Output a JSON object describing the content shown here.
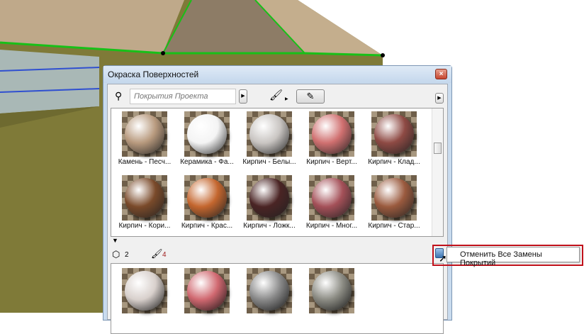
{
  "dialog": {
    "title": "Окраска Поверхностей",
    "close_icon": "×"
  },
  "toolbar": {
    "search_placeholder": "Покрытия Проекта",
    "arrow": "▶",
    "brush_icon": "🖌",
    "eyedropper_icon": "✎"
  },
  "materials": [
    {
      "label": "Камень - Песч...",
      "color": "#b89a7e"
    },
    {
      "label": "Керамика - Фа...",
      "color": "#f4f4f4"
    },
    {
      "label": "Кирпич - Белы...",
      "color": "#c9c5c2"
    },
    {
      "label": "Кирпич - Верт...",
      "color": "#d07070"
    },
    {
      "label": "Кирпич - Клад...",
      "color": "#8e4a44"
    },
    {
      "label": "Кирпич - Кори...",
      "color": "#7a4a2a"
    },
    {
      "label": "Кирпич - Крас...",
      "color": "#c4662e"
    },
    {
      "label": "Кирпич - Ложк...",
      "color": "#4a2424"
    },
    {
      "label": "Кирпич - Мног...",
      "color": "#a45058"
    },
    {
      "label": "Кирпич - Стар...",
      "color": "#9a5a3e"
    }
  ],
  "counts": {
    "elements": "2",
    "surfaces": "4"
  },
  "used_materials": [
    {
      "color": "#d8d0cc"
    },
    {
      "color": "#d06870"
    },
    {
      "color": "#8a8a8a"
    },
    {
      "color": "#8c8c84"
    }
  ],
  "tooltip": {
    "text": "Отменить Все Замены Покрытий"
  }
}
